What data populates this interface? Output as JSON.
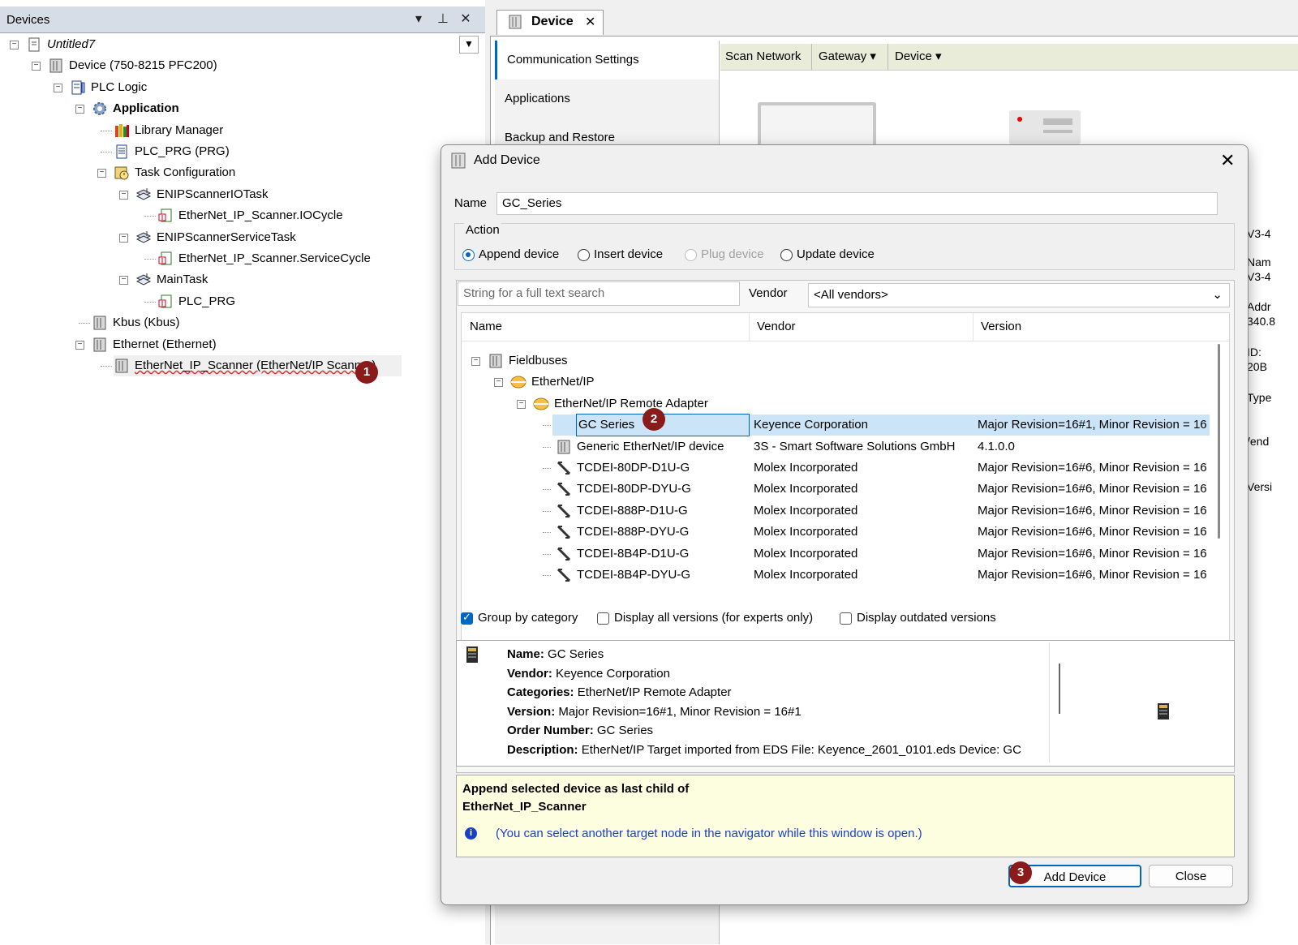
{
  "devices_panel": {
    "title": "Devices",
    "tree": [
      {
        "label": "Untitled7",
        "icon": "project-icon",
        "level": 0,
        "italic": true
      },
      {
        "label": "Device (750-8215 PFC200)",
        "icon": "device-icon",
        "level": 1
      },
      {
        "label": "PLC Logic",
        "icon": "plc-logic-icon",
        "level": 2
      },
      {
        "label": "Application",
        "icon": "application-gear-icon",
        "level": 3,
        "bold": true
      },
      {
        "label": "Library Manager",
        "icon": "library-icon",
        "level": 4
      },
      {
        "label": "PLC_PRG (PRG)",
        "icon": "program-icon",
        "level": 4
      },
      {
        "label": "Task Configuration",
        "icon": "task-config-icon",
        "level": 4
      },
      {
        "label": "ENIPScannerIOTask",
        "icon": "task-icon",
        "level": 5
      },
      {
        "label": "EtherNet_IP_Scanner.IOCycle",
        "icon": "pou-call-icon",
        "level": 6
      },
      {
        "label": "ENIPScannerServiceTask",
        "icon": "task-icon",
        "level": 5
      },
      {
        "label": "EtherNet_IP_Scanner.ServiceCycle",
        "icon": "pou-call-icon",
        "level": 6
      },
      {
        "label": "MainTask",
        "icon": "task-icon",
        "level": 5
      },
      {
        "label": "PLC_PRG",
        "icon": "pou-call-icon",
        "level": 6
      },
      {
        "label": "Kbus (Kbus)",
        "icon": "device-icon",
        "level": 3
      },
      {
        "label": "Ethernet (Ethernet)",
        "icon": "device-icon",
        "level": 3
      },
      {
        "label": "EtherNet_IP_Scanner (EtherNet/IP Scanner)",
        "icon": "device-icon",
        "level": 4,
        "selected": true
      }
    ],
    "badge_1": "1"
  },
  "editor": {
    "tab_label": "Device",
    "side_tabs": [
      "Communication Settings",
      "Applications",
      "Backup and Restore"
    ],
    "toolbar": {
      "scan": "Scan Network",
      "gateway": "Gateway",
      "device": "Device"
    },
    "peek_labels": [
      "V3-4",
      "Nam",
      "V3-4",
      "Addr",
      "340.8",
      "ID:",
      "20B",
      "Type",
      "/end",
      "Versi"
    ]
  },
  "dialog": {
    "title": "Add Device",
    "name_label": "Name",
    "name_value": "GC_Series",
    "action_label": "Action",
    "actions": [
      {
        "label": "Append device",
        "state": "on"
      },
      {
        "label": "Insert device",
        "state": "off"
      },
      {
        "label": "Plug device",
        "state": "disabled"
      },
      {
        "label": "Update device",
        "state": "off"
      }
    ],
    "search_placeholder": "String for a full text search",
    "vendor_label": "Vendor",
    "vendor_value": "<All vendors>",
    "columns": {
      "name": "Name",
      "vendor": "Vendor",
      "version": "Version"
    },
    "rows": [
      {
        "name": "Fieldbuses",
        "vendor": "",
        "version": "",
        "level": 0,
        "icon": "fieldbus-icon",
        "expander": true
      },
      {
        "name": "EtherNet/IP",
        "vendor": "",
        "version": "",
        "level": 1,
        "icon": "ethernet-ip-icon",
        "expander": true
      },
      {
        "name": "EtherNet/IP Remote Adapter",
        "vendor": "",
        "version": "",
        "level": 2,
        "icon": "ethernet-ip-icon",
        "expander": true
      },
      {
        "name": "GC Series",
        "vendor": "Keyence Corporation",
        "version": "Major Revision=16#1, Minor Revision = 16",
        "level": 3,
        "icon": "gc-module-icon",
        "selected": true
      },
      {
        "name": "Generic EtherNet/IP device",
        "vendor": "3S - Smart Software Solutions GmbH",
        "version": "4.1.0.0",
        "level": 3,
        "icon": "device-icon"
      },
      {
        "name": "TCDEI-80DP-D1U-G",
        "vendor": "Molex Incorporated",
        "version": "Major Revision=16#6, Minor Revision = 16",
        "level": 3,
        "icon": "molex-module-icon"
      },
      {
        "name": "TCDEI-80DP-DYU-G",
        "vendor": "Molex Incorporated",
        "version": "Major Revision=16#6, Minor Revision = 16",
        "level": 3,
        "icon": "molex-module-icon"
      },
      {
        "name": "TCDEI-888P-D1U-G",
        "vendor": "Molex Incorporated",
        "version": "Major Revision=16#6, Minor Revision = 16",
        "level": 3,
        "icon": "molex-module-icon"
      },
      {
        "name": "TCDEI-888P-DYU-G",
        "vendor": "Molex Incorporated",
        "version": "Major Revision=16#6, Minor Revision = 16",
        "level": 3,
        "icon": "molex-module-icon"
      },
      {
        "name": "TCDEI-8B4P-D1U-G",
        "vendor": "Molex Incorporated",
        "version": "Major Revision=16#6, Minor Revision = 16",
        "level": 3,
        "icon": "molex-module-icon"
      },
      {
        "name": "TCDEI-8B4P-DYU-G",
        "vendor": "Molex Incorporated",
        "version": "Major Revision=16#6, Minor Revision = 16",
        "level": 3,
        "icon": "molex-module-icon"
      }
    ],
    "badge_2": "2",
    "checkboxes": [
      {
        "label": "Group by category",
        "checked": true
      },
      {
        "label": "Display all versions (for experts only)",
        "checked": false
      },
      {
        "label": "Display outdated versions",
        "checked": false
      }
    ],
    "info": {
      "name_k": "Name:",
      "name_v": "GC Series",
      "vendor_k": "Vendor:",
      "vendor_v": "Keyence Corporation",
      "cat_k": "Categories:",
      "cat_v": "EtherNet/IP Remote Adapter",
      "ver_k": "Version:",
      "ver_v": "Major Revision=16#1, Minor Revision = 16#1",
      "order_k": "Order Number:",
      "order_v": "GC Series",
      "desc_k": "Description:",
      "desc_v": "EtherNet/IP Target imported from EDS File: Keyence_2601_0101.eds Device: GC"
    },
    "append_line1": "Append selected device as last child of",
    "append_line2": "EtherNet_IP_Scanner",
    "append_hint": "(You can select another target node in the navigator while this window is open.)",
    "badge_3": "3",
    "add_button": "Add Device",
    "close_button": "Close"
  },
  "colors": {
    "accent": "#0067c0",
    "badge": "#8b1a1a",
    "selection": "#cce4f7",
    "hint_bg": "#fdfde0",
    "hint_text": "#1a3fc7"
  }
}
